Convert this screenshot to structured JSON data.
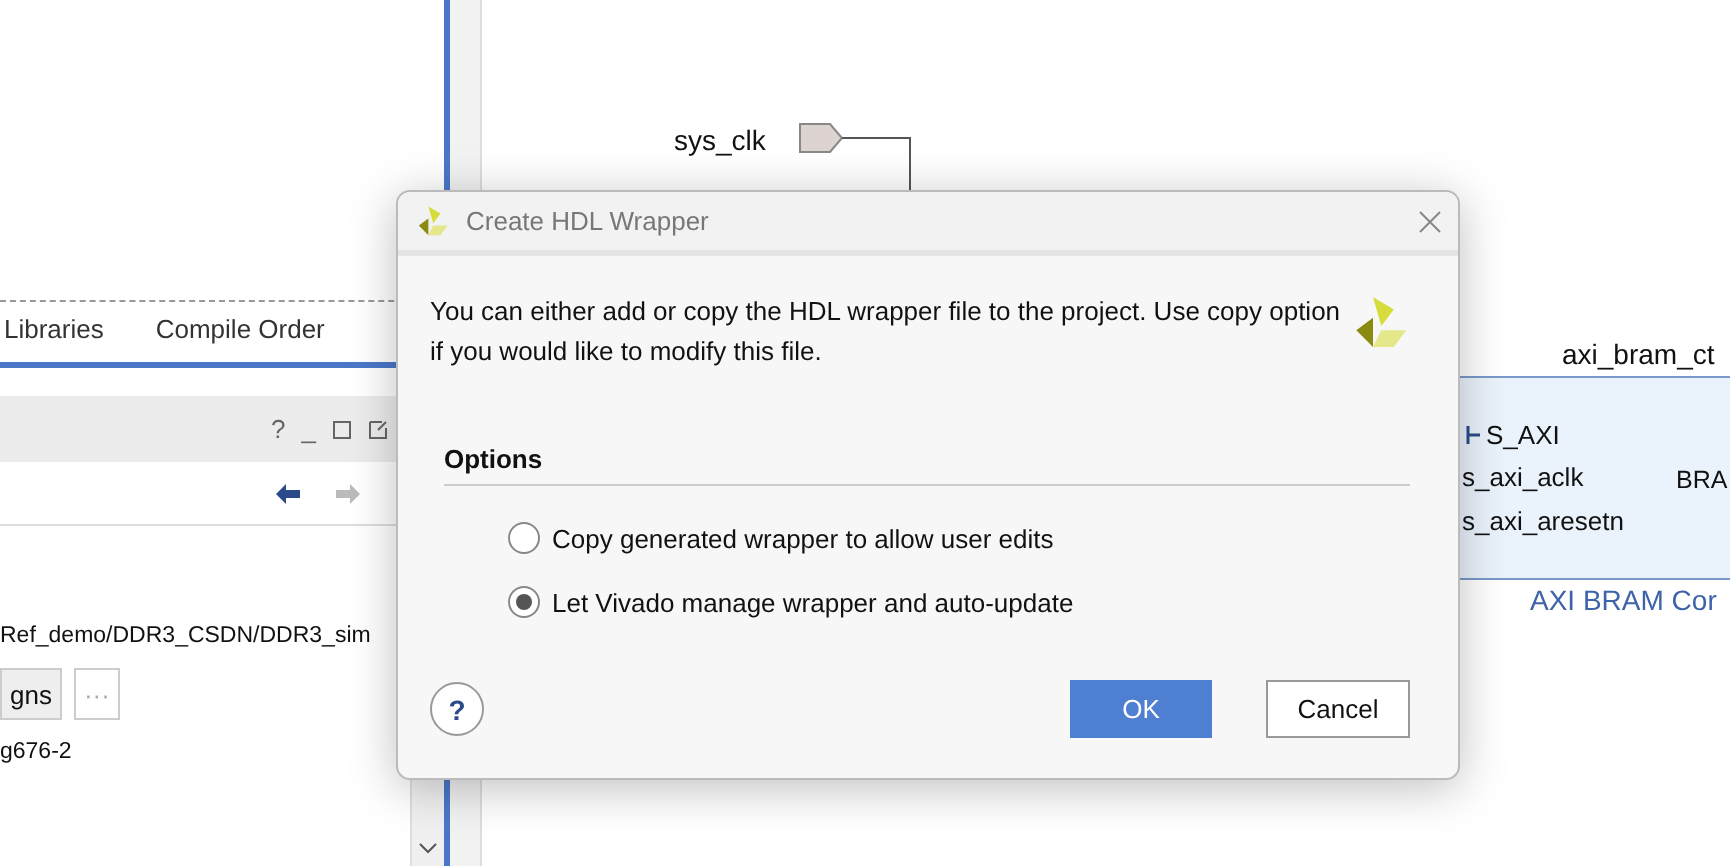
{
  "left_panel": {
    "tabs": [
      {
        "label": "Libraries",
        "selected": false
      },
      {
        "label": "Compile Order",
        "selected": false
      }
    ],
    "header_icons": [
      "?",
      "_"
    ],
    "path_text": "Ref_demo/DDR3_CSDN/DDR3_sim",
    "designs_button": "gns",
    "more_button": "···",
    "part_text": "g676-2"
  },
  "diagram": {
    "port": "sys_clk",
    "block_title": "axi_bram_ct",
    "interface": "S_AXI",
    "pins": [
      "s_axi_aclk",
      "s_axi_aresetn"
    ],
    "right_pin": "BRA",
    "block_caption": "AXI BRAM Cor"
  },
  "dialog": {
    "title": "Create HDL Wrapper",
    "message": "You can either add or copy the HDL wrapper file to the project. Use copy option if you would like to modify this file.",
    "section": "Options",
    "options": [
      {
        "label": "Copy generated wrapper to allow user edits",
        "selected": false
      },
      {
        "label": "Let Vivado manage wrapper and auto-update",
        "selected": true
      }
    ],
    "help": "?",
    "ok": "OK",
    "cancel": "Cancel"
  }
}
